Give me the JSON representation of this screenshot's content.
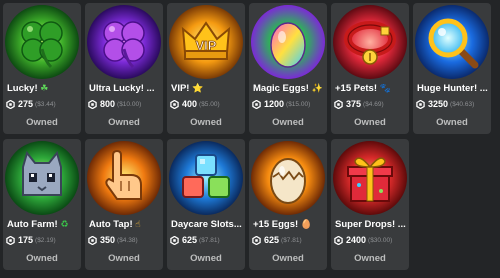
{
  "items": [
    {
      "name": "Lucky!",
      "emoji": "☘",
      "price": "275",
      "usd": "($3.44)",
      "status": "Owned",
      "icon": "clover-icon",
      "bg": "#3fb02a"
    },
    {
      "name": "Ultra Lucky! ...",
      "emoji": "",
      "price": "800",
      "usd": "($10.00)",
      "status": "Owned",
      "icon": "purple-clover-icon",
      "bg": "#7b2ad6"
    },
    {
      "name": "VIP!",
      "emoji": "⭐",
      "price": "400",
      "usd": "($5.00)",
      "status": "Owned",
      "icon": "vip-crown-icon",
      "bg": "#f59a11"
    },
    {
      "name": "Magic Eggs!",
      "emoji": "✨",
      "price": "1200",
      "usd": "($15.00)",
      "status": "Owned",
      "icon": "magic-egg-icon",
      "bg": "#2fb05a"
    },
    {
      "name": "+15 Pets!",
      "emoji": "🐾",
      "price": "375",
      "usd": "($4.69)",
      "status": "Owned",
      "icon": "pet-collar-icon",
      "bg": "#e0283a"
    },
    {
      "name": "Huge Hunter! ...",
      "emoji": "",
      "price": "3250",
      "usd": "($40.63)",
      "status": "Owned",
      "icon": "magnifying-glass-icon",
      "bg": "#1a6be0"
    },
    {
      "name": "Auto Farm!",
      "emoji": "♻",
      "price": "175",
      "usd": "($2.19)",
      "status": "Owned",
      "icon": "cat-pet-icon",
      "bg": "#2ea83a"
    },
    {
      "name": "Auto Tap!",
      "emoji": "☝",
      "price": "350",
      "usd": "($4.38)",
      "status": "Owned",
      "icon": "tapping-hand-icon",
      "bg": "#f07a10"
    },
    {
      "name": "Daycare Slots...",
      "emoji": "",
      "price": "625",
      "usd": "($7.81)",
      "status": "Owned",
      "icon": "daycare-blocks-icon",
      "bg": "#1e7ad8"
    },
    {
      "name": "+15 Eggs!",
      "emoji": "🥚",
      "price": "625",
      "usd": "($7.81)",
      "status": "Owned",
      "icon": "cracked-egg-icon",
      "bg": "#f58a10"
    },
    {
      "name": "Super Drops! ...",
      "emoji": "",
      "price": "2400",
      "usd": "($30.00)",
      "status": "Owned",
      "icon": "gift-box-icon",
      "bg": "#d82a2a"
    }
  ]
}
